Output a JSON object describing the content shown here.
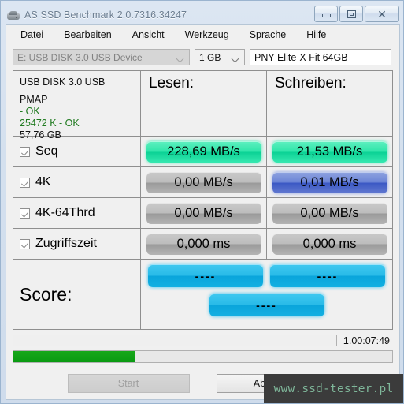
{
  "window": {
    "title": "AS SSD Benchmark 2.0.7316.34247",
    "icon": "drive-icon",
    "buttons": {
      "minimize": "minimize-icon",
      "maximize": "restore-icon",
      "close": "close-icon"
    }
  },
  "menu": {
    "items": [
      {
        "label": "Datei"
      },
      {
        "label": "Bearbeiten"
      },
      {
        "label": "Ansicht"
      },
      {
        "label": "Werkzeug"
      },
      {
        "label": "Sprache"
      },
      {
        "label": "Hilfe"
      }
    ]
  },
  "controls": {
    "device": {
      "value": "E: USB DISK 3.0 USB Device",
      "enabled": false
    },
    "size": {
      "value": "1 GB"
    },
    "name": {
      "value": "PNY Elite-X Fit 64GB",
      "placeholder": ""
    }
  },
  "info": {
    "model": "USB DISK 3.0 USB",
    "firmware": "PMAP",
    "align_status": "- OK",
    "offset": "25472 K - OK",
    "capacity": "57,76 GB",
    "ok_color": "#1f7a1f"
  },
  "columns": {
    "read": "Lesen:",
    "write": "Schreiben:"
  },
  "rows": [
    {
      "label": "Seq",
      "checked": true,
      "read": {
        "value": "228,69 MB/s",
        "style": "green"
      },
      "write": {
        "value": "21,53 MB/s",
        "style": "green"
      }
    },
    {
      "label": "4K",
      "checked": true,
      "read": {
        "value": "0,00 MB/s",
        "style": "gray"
      },
      "write": {
        "value": "0,01 MB/s",
        "style": "blue"
      }
    },
    {
      "label": "4K-64Thrd",
      "checked": true,
      "read": {
        "value": "0,00 MB/s",
        "style": "gray"
      },
      "write": {
        "value": "0,00 MB/s",
        "style": "gray"
      }
    },
    {
      "label": "Zugriffszeit",
      "checked": true,
      "read": {
        "value": "0,000 ms",
        "style": "gray"
      },
      "write": {
        "value": "0,000 ms",
        "style": "gray"
      }
    }
  ],
  "score": {
    "label": "Score:",
    "read": "----",
    "write": "----",
    "total": "----",
    "style": "cyan"
  },
  "status": {
    "timer": "1.00:07:49",
    "progress_percent": 32
  },
  "footer": {
    "start": "Start",
    "start_enabled": false,
    "cancel": "Abbrechen"
  },
  "watermark": {
    "text": "www.ssd-tester.pl"
  },
  "colors": {
    "green_badge": "#2fe5a9",
    "blue_badge": "#6b84d6",
    "cyan_badge": "#29bbe8",
    "gray_badge": "#bdbdbd",
    "progress": "#17a81a",
    "titlebar_text": "#6d7f92"
  }
}
